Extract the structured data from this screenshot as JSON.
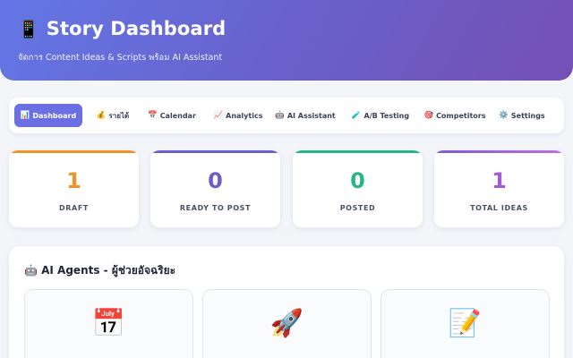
{
  "header": {
    "icon": "📱",
    "title": "Story Dashboard",
    "subtitle": "จัดการ Content Ideas & Scripts พร้อม AI Assistant"
  },
  "nav": {
    "tabs": [
      {
        "icon": "📊",
        "label": "Dashboard",
        "active": true
      },
      {
        "icon": "💰",
        "label": "รายได้",
        "active": false
      },
      {
        "icon": "📅",
        "label": "Calendar",
        "active": false
      },
      {
        "icon": "📈",
        "label": "Analytics",
        "active": false
      },
      {
        "icon": "🤖",
        "label": "AI Assistant",
        "active": false
      },
      {
        "icon": "🧪",
        "label": "A/B Testing",
        "active": false
      },
      {
        "icon": "🎯",
        "label": "Competitors",
        "active": false
      },
      {
        "icon": "⚙️",
        "label": "Settings",
        "active": false
      }
    ]
  },
  "stats": [
    {
      "value": "1",
      "label": "DRAFT",
      "color": "#f0922a"
    },
    {
      "value": "0",
      "label": "READY TO POST",
      "color": "#6a5fc9"
    },
    {
      "value": "0",
      "label": "POSTED",
      "color": "#27b585"
    },
    {
      "value": "1",
      "label": "TOTAL IDEAS",
      "color": "#a35bd0"
    }
  ],
  "agents": {
    "title": "🤖 AI Agents - ผู้ช่วยอัจฉริยะ",
    "cards": [
      {
        "icon": "📅",
        "icon_name": "calendar-icon"
      },
      {
        "icon": "🚀",
        "icon_name": "rocket-icon"
      },
      {
        "icon": "📝",
        "icon_name": "memo-icon"
      }
    ]
  }
}
